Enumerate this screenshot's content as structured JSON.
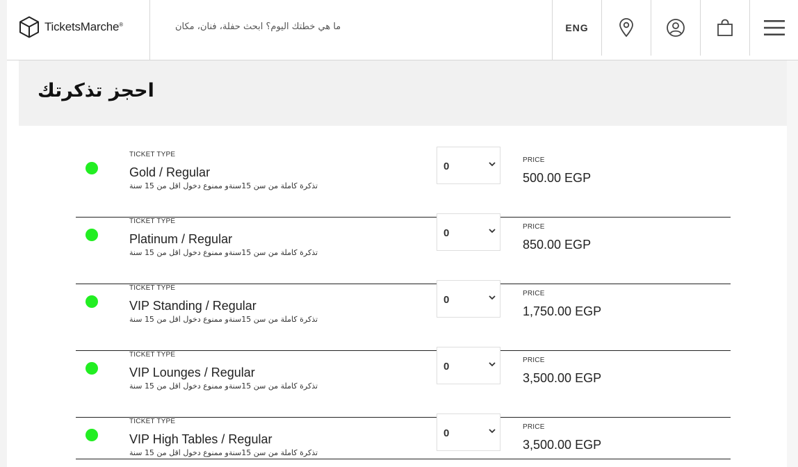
{
  "brand": {
    "name": "TicketsMarche",
    "mark": "®"
  },
  "search": {
    "placeholder": "ما هي خطتك اليوم؟ ابحث حفلة، فنان، مكان"
  },
  "header": {
    "language": "ENG"
  },
  "page": {
    "title": "احجز تذكرتك"
  },
  "ticket_type_label": "TICKET TYPE",
  "price_label": "PRICE",
  "tickets": [
    {
      "name": "Gold / Regular",
      "description": "تذكرة كاملة من سن 15سنةو ممنوع دخول اقل من 15 سنة",
      "quantity": "0",
      "price": "500.00 EGP"
    },
    {
      "name": "Platinum / Regular",
      "description": "تذكرة كاملة من سن 15سنةو ممنوع دخول اقل من 15 سنة",
      "quantity": "0",
      "price": "850.00 EGP"
    },
    {
      "name": "VIP Standing / Regular",
      "description": "تذكرة كاملة من سن 15سنةو ممنوع دخول اقل من 15 سنة",
      "quantity": "0",
      "price": "1,750.00 EGP"
    },
    {
      "name": "VIP Lounges / Regular",
      "description": "تذكرة كاملة من سن 15سنةو ممنوع دخول اقل من 15 سنة",
      "quantity": "0",
      "price": "3,500.00 EGP"
    },
    {
      "name": "VIP High Tables / Regular",
      "description": "تذكرة كاملة من سن 15سنةو ممنوع دخول اقل من 15 سنة",
      "quantity": "0",
      "price": "3,500.00 EGP"
    }
  ],
  "colors": {
    "available_dot": "#22ee22",
    "border": "#d6d6d6",
    "title_band": "#f1f1f1"
  },
  "icons": [
    "box-logo-icon",
    "location-pin-icon",
    "user-circle-icon",
    "shopping-bag-icon",
    "hamburger-menu-icon",
    "chevron-down-icon"
  ]
}
